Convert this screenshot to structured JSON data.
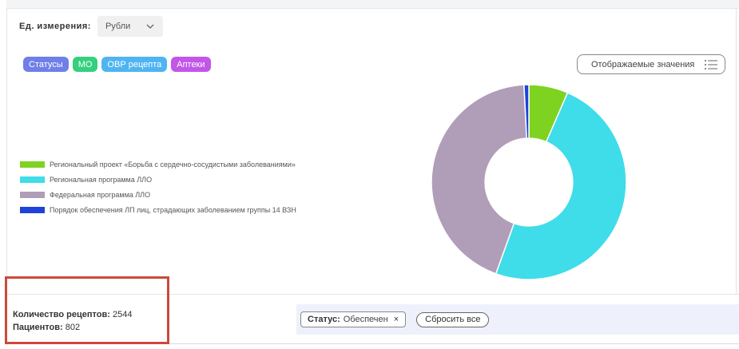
{
  "unit": {
    "label": "Ед. измерения:",
    "selected": "Рубли"
  },
  "tags": [
    {
      "label": "Статусы",
      "color": "#6f7fe8"
    },
    {
      "label": "МО",
      "color": "#35d07f"
    },
    {
      "label": "ОВР рецепта",
      "color": "#4fb4f2"
    },
    {
      "label": "Аптеки",
      "color": "#c156e8"
    }
  ],
  "values_button": {
    "label": "Отображаемые значения",
    "icon": "list-icon"
  },
  "chart_data": {
    "type": "pie",
    "hole": 0.45,
    "start_angle": 0,
    "categories": [
      "Региональный проект «Борьба с сердечно-сосудистыми заболеваниями»",
      "Региональная программа ЛЛО",
      "Федеральная программа ЛЛО",
      "Порядок обеспечения ЛП лиц, страдающих заболеванием группы 14 ВЗН"
    ],
    "values": [
      6.5,
      49.0,
      43.7,
      0.8
    ],
    "colors": [
      "#7ed321",
      "#3fdcea",
      "#b09db8",
      "#1f43d8"
    ],
    "legend_position": "left"
  },
  "stats": {
    "recipes_label": "Количество рецептов:",
    "recipes_value": "2544",
    "patients_label": "Пациентов:",
    "patients_value": "802"
  },
  "filter": {
    "chip_key": "Статус:",
    "chip_value": "Обеспечен",
    "chip_close": "×",
    "reset_label": "Сбросить все"
  },
  "highlight_color": "#cc4a3b"
}
